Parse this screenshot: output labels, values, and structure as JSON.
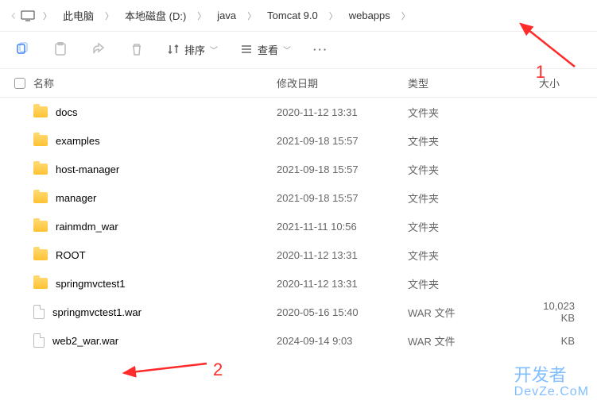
{
  "breadcrumb": {
    "items": [
      "此电脑",
      "本地磁盘 (D:)",
      "java",
      "Tomcat 9.0",
      "webapps"
    ]
  },
  "toolbar": {
    "sort_label": "排序",
    "view_label": "查看"
  },
  "columns": {
    "name": "名称",
    "modified": "修改日期",
    "type": "类型",
    "size": "大小"
  },
  "rows": [
    {
      "icon": "folder",
      "name": "docs",
      "modified": "2020-11-12 13:31",
      "type": "文件夹",
      "size": ""
    },
    {
      "icon": "folder",
      "name": "examples",
      "modified": "2021-09-18 15:57",
      "type": "文件夹",
      "size": ""
    },
    {
      "icon": "folder",
      "name": "host-manager",
      "modified": "2021-09-18 15:57",
      "type": "文件夹",
      "size": ""
    },
    {
      "icon": "folder",
      "name": "manager",
      "modified": "2021-09-18 15:57",
      "type": "文件夹",
      "size": ""
    },
    {
      "icon": "folder",
      "name": "rainmdm_war",
      "modified": "2021-11-11 10:56",
      "type": "文件夹",
      "size": ""
    },
    {
      "icon": "folder",
      "name": "ROOT",
      "modified": "2020-11-12 13:31",
      "type": "文件夹",
      "size": ""
    },
    {
      "icon": "folder",
      "name": "springmvctest1",
      "modified": "2020-11-12 13:31",
      "type": "文件夹",
      "size": ""
    },
    {
      "icon": "file",
      "name": "springmvctest1.war",
      "modified": "2020-05-16 15:40",
      "type": "WAR 文件",
      "size": "10,023 KB"
    },
    {
      "icon": "file",
      "name": "web2_war.war",
      "modified": "2024-09-14 9:03",
      "type": "WAR 文件",
      "size": "KB"
    }
  ],
  "annotations": {
    "one": "1",
    "two": "2"
  },
  "watermark": {
    "line1": "开发者",
    "line2": "DevZe.CoM"
  }
}
